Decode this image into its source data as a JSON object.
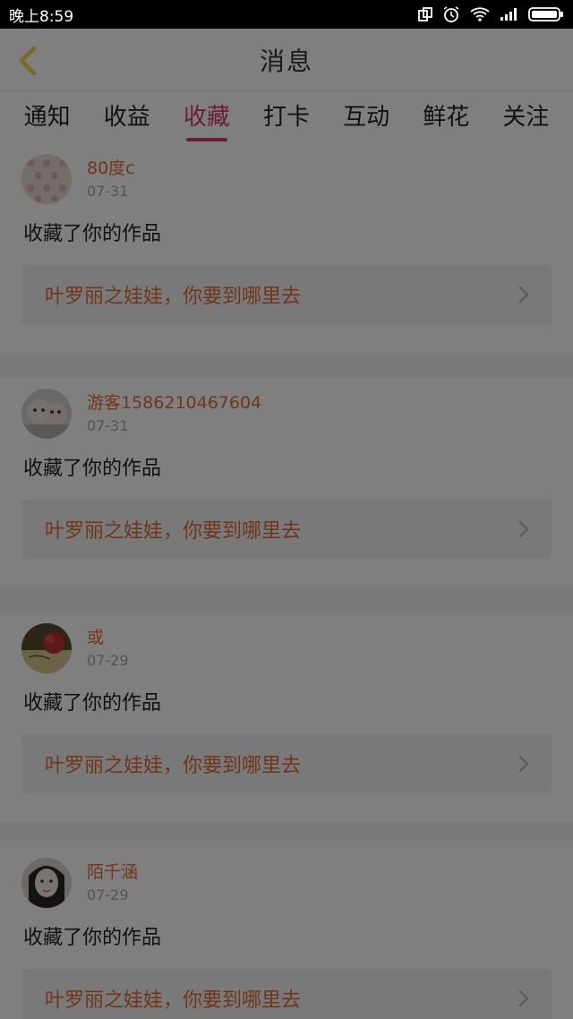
{
  "status_bar": {
    "time": "晚上8:59",
    "icons": [
      "screen-rotate-icon",
      "alarm-icon",
      "wifi-icon",
      "signal-icon",
      "battery-icon"
    ]
  },
  "header": {
    "title": "消息",
    "back_icon": "back-chevron-icon"
  },
  "tabs": [
    {
      "label": "通知",
      "active": false
    },
    {
      "label": "收益",
      "active": false
    },
    {
      "label": "收藏",
      "active": true
    },
    {
      "label": "打卡",
      "active": false
    },
    {
      "label": "互动",
      "active": false
    },
    {
      "label": "鲜花",
      "active": false
    },
    {
      "label": "关注",
      "active": false
    }
  ],
  "items": [
    {
      "username": "80度c",
      "date": "07-31",
      "action": "收藏了你的作品",
      "work_title": "叶罗丽之娃娃，你要到哪里去"
    },
    {
      "username": "游客1586210467604",
      "date": "07-31",
      "action": "收藏了你的作品",
      "work_title": "叶罗丽之娃娃，你要到哪里去"
    },
    {
      "username": "或",
      "date": "07-29",
      "action": "收藏了你的作品",
      "work_title": "叶罗丽之娃娃，你要到哪里去"
    },
    {
      "username": "陌千涵",
      "date": "07-29",
      "action": "收藏了你的作品",
      "work_title": "叶罗丽之娃娃，你要到哪里去"
    }
  ],
  "colors": {
    "accent": "#d23a6f",
    "username": "#e26b35",
    "link_bg": "#f2f2f2"
  }
}
